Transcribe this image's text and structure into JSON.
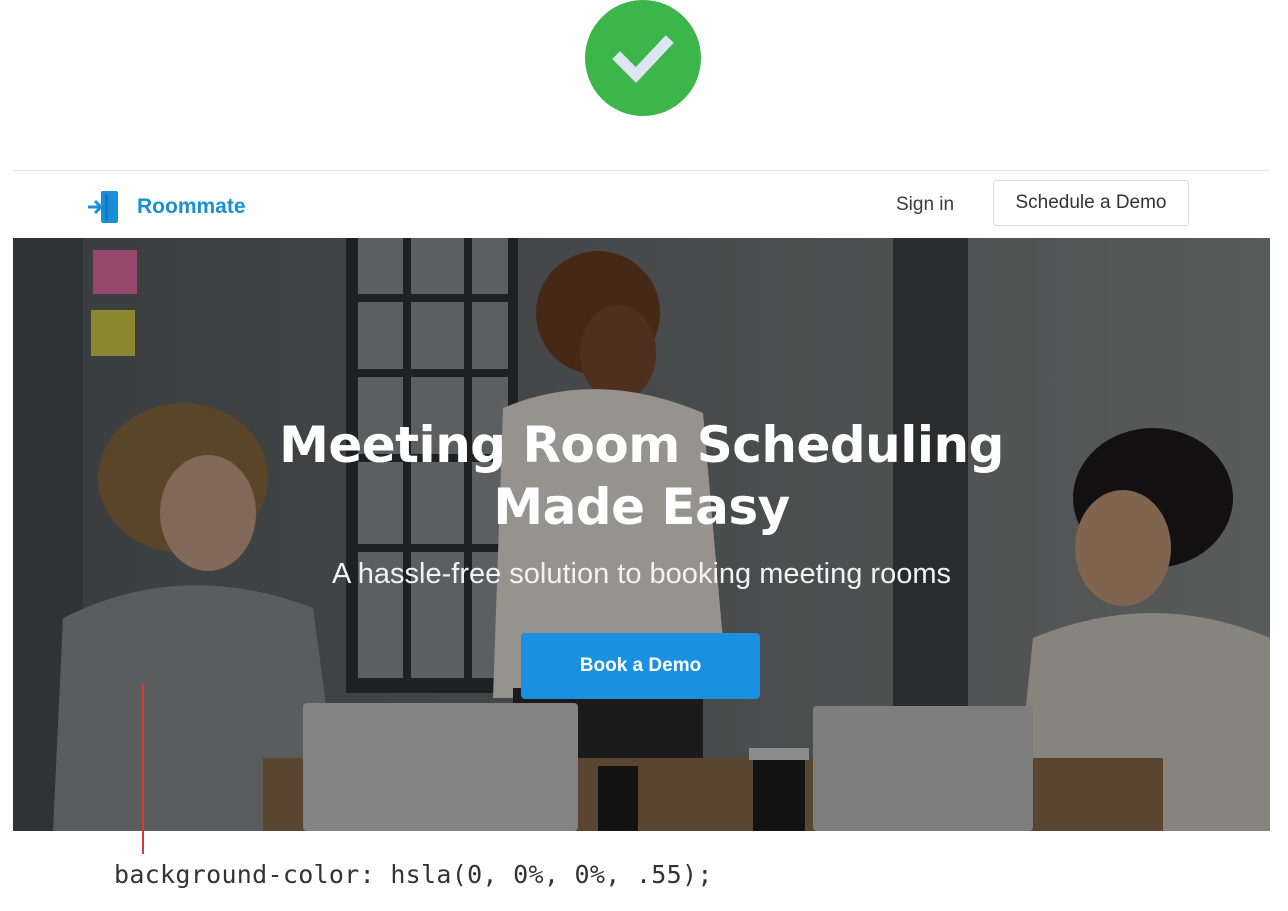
{
  "status": {
    "icon": "checkmark-icon",
    "color": "#3cb54a"
  },
  "navbar": {
    "logo_icon": "door-enter-icon",
    "brand": "Roommate",
    "brand_color": "#1a8fd8",
    "signin_label": "Sign in",
    "demo_label": "Schedule a Demo"
  },
  "hero": {
    "title_line1": "Meeting Room Scheduling",
    "title_line2": "Made Easy",
    "subtitle": "A hassle-free solution to booking meeting rooms",
    "cta_label": "Book a Demo",
    "cta_color": "#1a90e0"
  },
  "annotation": {
    "css_rule": "background-color: hsla(0, 0%, 0%, .55);"
  }
}
